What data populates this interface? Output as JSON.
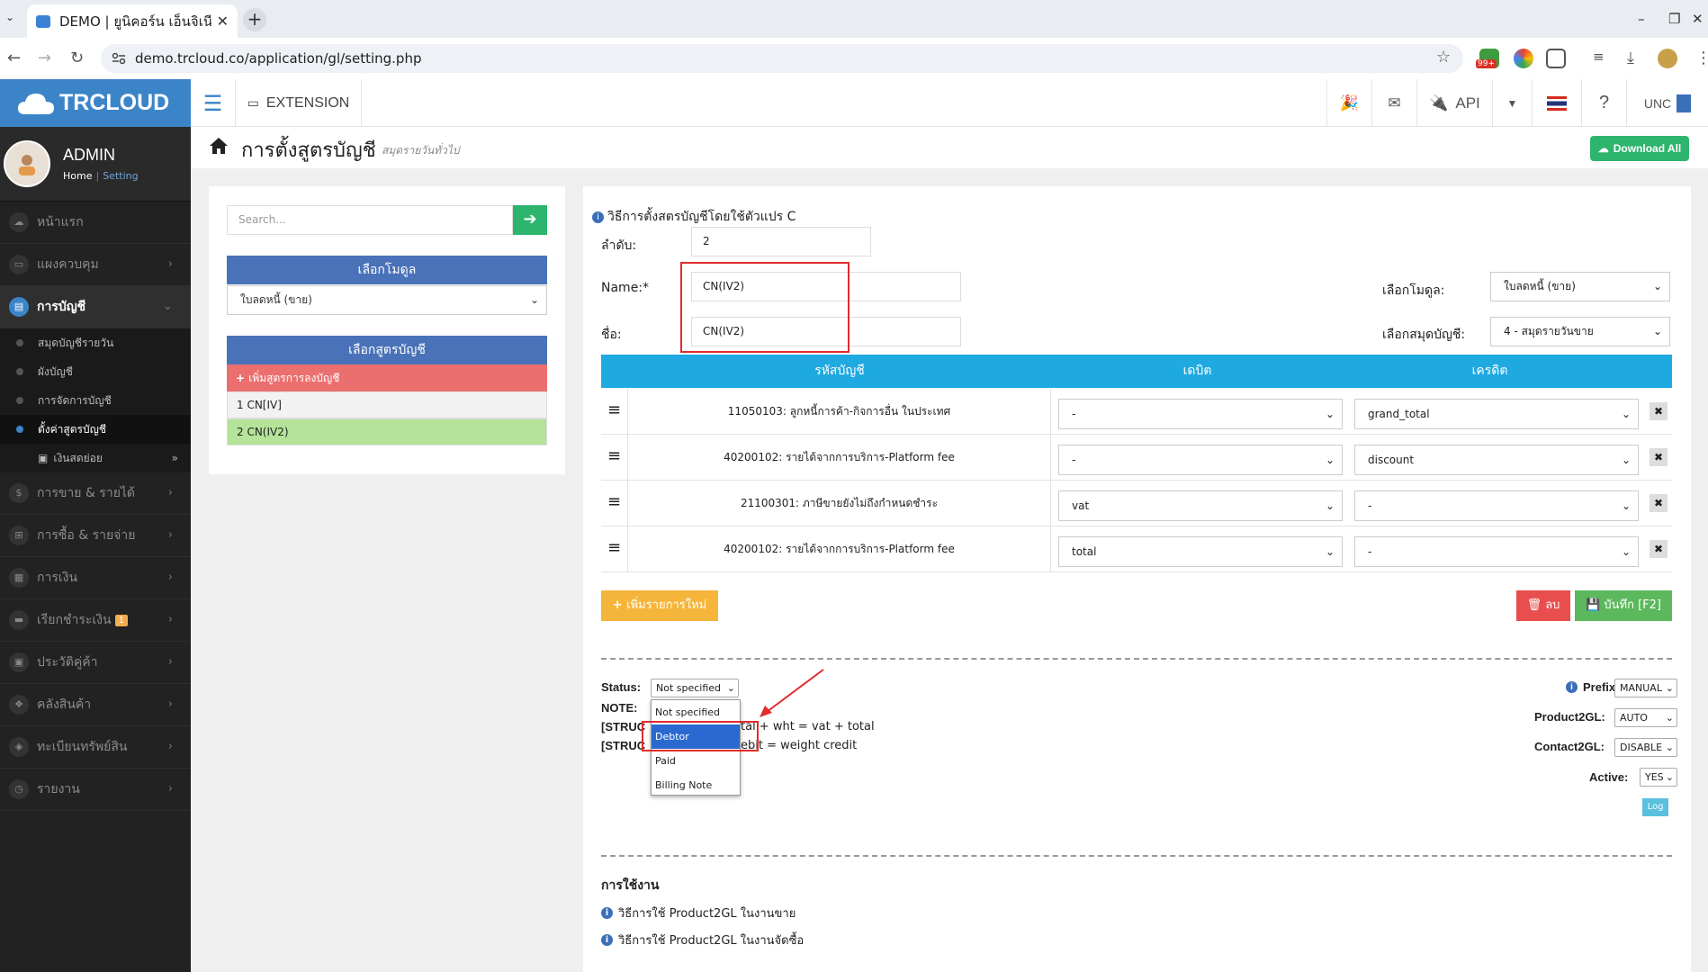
{
  "browser": {
    "tab_title": "DEMO | ยูนิคอร์น เอ็นจิเนี",
    "url": "demo.trcloud.co/application/gl/setting.php",
    "badge_count": "99+"
  },
  "header": {
    "logo_text": "TRCLOUD",
    "extension_label": "EXTENSION",
    "api_label": "API",
    "user_short": "UNC"
  },
  "profile": {
    "name": "ADMIN",
    "breadcrumb_home": "Home",
    "breadcrumb_current": "Setting"
  },
  "sidebar": {
    "items": [
      {
        "label": "หน้าแรก"
      },
      {
        "label": "แผงควบคุม"
      },
      {
        "label": "การบัญชี"
      },
      {
        "label": "การขาย & รายได้"
      },
      {
        "label": "การซื้อ & รายจ่าย"
      },
      {
        "label": "การเงิน"
      },
      {
        "label": "เรียกชำระเงิน",
        "badge": "1"
      },
      {
        "label": "ประวัติคู่ค้า"
      },
      {
        "label": "คลังสินค้า"
      },
      {
        "label": "ทะเบียนทรัพย์สิน"
      },
      {
        "label": "รายงาน"
      }
    ],
    "subitems": [
      {
        "label": "สมุดบัญชีรายวัน"
      },
      {
        "label": "ผังบัญชี"
      },
      {
        "label": "การจัดการบัญชี"
      },
      {
        "label": "ตั้งค่าสูตรบัญชี"
      },
      {
        "label": "เงินสดย่อย"
      }
    ]
  },
  "page": {
    "title": "การตั้งสูตรบัญชี",
    "subtitle": "สมุดรายวันทั่วไป",
    "download_all": "Download All"
  },
  "left_panel": {
    "search_placeholder": "Search...",
    "module_header": "เลือกโมดูล",
    "module_value": "ใบลดหนี้ (ขาย)",
    "formula_header": "เลือกสูตรบัญชี",
    "add_formula": "เพิ่มสูตรการลงบัญชี",
    "formulas": [
      "1 CN[IV]",
      "2 CN(IV2)"
    ]
  },
  "form": {
    "info": "วิธีการตั้งสตรบัญชีโดยใช้ตัวแปร C",
    "order_label": "ลำดับ:",
    "order_value": "2",
    "name_label": "Name:*",
    "name_value": "CN(IV2)",
    "thai_name_label": "ชื่อ:",
    "thai_name_value": "CN(IV2)",
    "module_label": "เลือกโมดูล:",
    "module_value": "ใบลดหนี้ (ขาย)",
    "journal_label": "เลือกสมุดบัญชี:",
    "journal_value": "4 - สมุดรายวันขาย"
  },
  "table": {
    "headers": [
      "รหัสบัญชี",
      "เดบิต",
      "เครดิต"
    ],
    "rows": [
      {
        "account": "11050103: ลูกหนี้การค้า-กิจการอื่น ในประเทศ",
        "debit": "-",
        "credit": "grand_total"
      },
      {
        "account": "40200102: รายได้จากการบริการ-Platform fee",
        "debit": "-",
        "credit": "discount"
      },
      {
        "account": "21100301: ภาษีขายยังไม่ถึงกำหนดชำระ",
        "debit": "vat",
        "credit": "-"
      },
      {
        "account": "40200102: รายได้จากการบริการ-Platform fee",
        "debit": "total",
        "credit": "-"
      }
    ]
  },
  "actions": {
    "add_row": "เพิ่มรายการใหม่",
    "delete": "ลบ",
    "save": "บันทึก [F2]"
  },
  "bottom": {
    "status_label": "Status:",
    "status_value": "Not specified",
    "note_label": "NOTE:",
    "struct1_a": "[STRUC",
    "struct1_b": "tal + wht = vat + total",
    "struct2_a": "[STRUC",
    "struct2_b": "ebit = weight credit",
    "status_options": [
      "Not specified",
      "Debtor",
      "Paid",
      "Billing Note"
    ],
    "prefix_label": "Prefix:",
    "prefix_value": "MANUAL",
    "p2gl_label": "Product2GL:",
    "p2gl_value": "AUTO",
    "c2gl_label": "Contact2GL:",
    "c2gl_value": "DISABLE",
    "active_label": "Active:",
    "active_value": "YES",
    "log": "Log",
    "usage_title": "การใช้งาน",
    "usage1": "วิธีการใช้ Product2GL ในงานขาย",
    "usage2": "วิธีการใช้ Product2GL ในงานจัดซื้อ"
  },
  "colors": {
    "brand_blue": "#3b84c8",
    "table_header": "#1fa9e1",
    "highlight_red": "#e32b2b",
    "sidebar_bg": "#222222"
  }
}
